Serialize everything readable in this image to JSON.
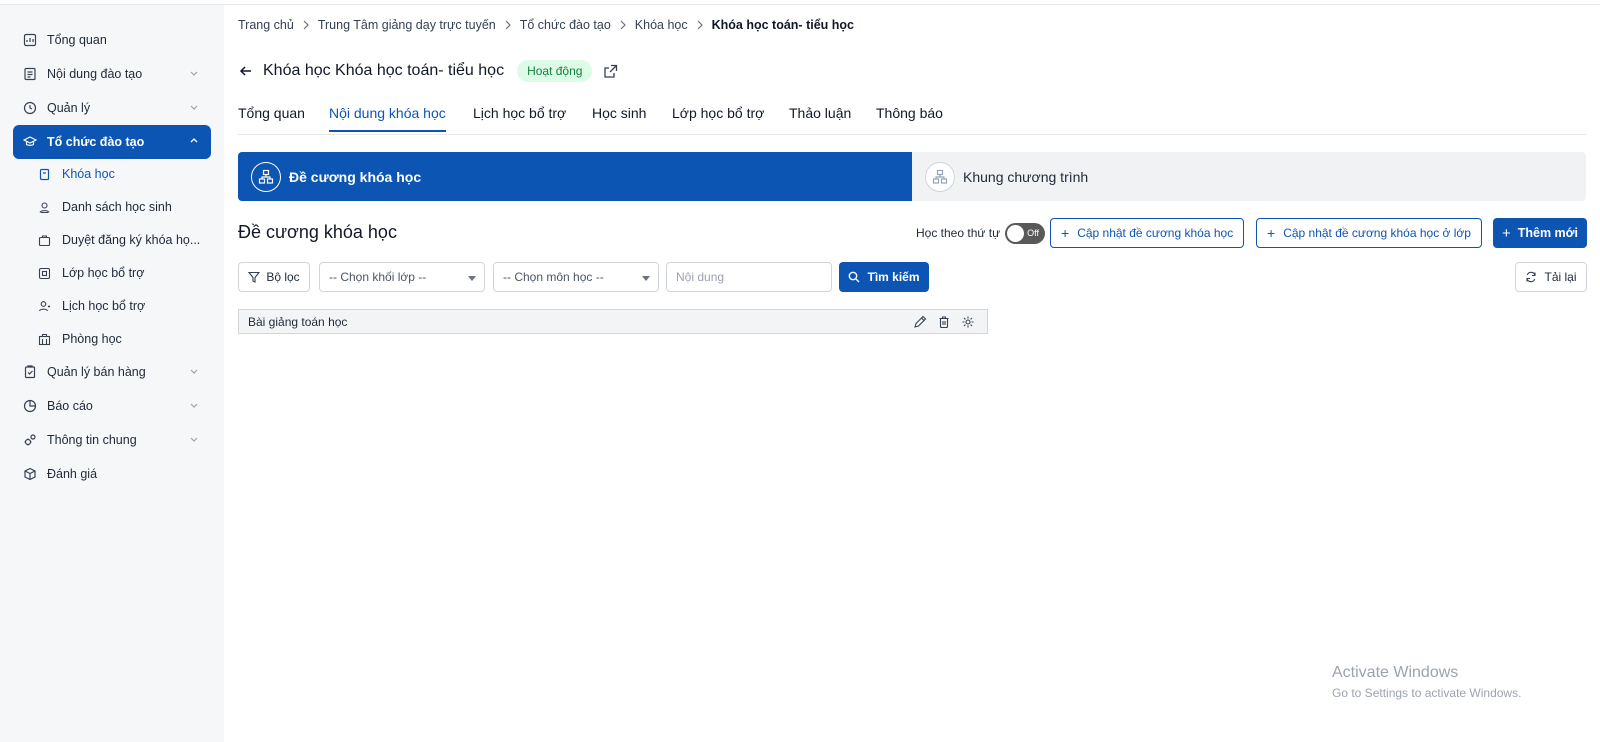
{
  "sidebar": {
    "items": [
      {
        "label": "Tổng quan",
        "icon": "dashboard-icon"
      },
      {
        "label": "Nội dung đào tạo",
        "icon": "document-icon"
      },
      {
        "label": "Quản lý",
        "icon": "check-circle-icon"
      },
      {
        "label": "Tổ chức đào tạo",
        "icon": "graduation-cap-icon"
      },
      {
        "label": "Quản lý bán hàng",
        "icon": "clipboard-check-icon"
      },
      {
        "label": "Báo cáo",
        "icon": "pie-chart-icon"
      },
      {
        "label": "Thông tin chung",
        "icon": "gears-icon"
      },
      {
        "label": "Đánh giá",
        "icon": "cube-icon"
      }
    ],
    "subitems": [
      {
        "label": "Khóa học",
        "icon": "book-icon"
      },
      {
        "label": "Danh sách học sinh",
        "icon": "student-icon"
      },
      {
        "label": "Duyệt đăng ký khóa họ...",
        "icon": "briefcase-icon"
      },
      {
        "label": "Lớp học bổ trợ",
        "icon": "classroom-icon"
      },
      {
        "label": "Lịch học bổ trợ",
        "icon": "user-schedule-icon"
      },
      {
        "label": "Phòng học",
        "icon": "building-icon"
      }
    ]
  },
  "breadcrumb": [
    "Trang chủ",
    "Trung Tâm giảng dạy trực tuyến",
    "Tổ chức đào tạo",
    "Khóa học",
    "Khóa học toán- tiểu học"
  ],
  "header": {
    "title": "Khóa học Khóa học toán- tiểu học",
    "status": "Hoạt động"
  },
  "tabs": [
    "Tổng quan",
    "Nội dung khóa học",
    "Lịch học bổ trợ",
    "Học sinh",
    "Lớp học bổ trợ",
    "Thảo luận",
    "Thông báo"
  ],
  "steps": [
    "Đề cương khóa học",
    "Khung chương trình"
  ],
  "section": {
    "title": "Đề cương khóa học",
    "order_label": "Học theo thứ tự",
    "toggle_text": "Off",
    "update_outline": "Cập nhật đề cương khóa học",
    "update_outline_class": "Cập nhật đề cương khóa học ở lớp",
    "add_new": "Thêm mới"
  },
  "filters": {
    "filter_label": "Bộ lọc",
    "grade_select": "-- Chọn khối lớp --",
    "subject_select": "-- Chọn môn học --",
    "content_placeholder": "Nội dung",
    "search_label": "Tìm kiếm",
    "reload_label": "Tải lại"
  },
  "rows": [
    {
      "title": "Bài giảng toán học"
    }
  ],
  "watermark": {
    "line1": "Activate Windows",
    "line2": "Go to Settings to activate Windows."
  },
  "colors": {
    "primary": "#0d55b2",
    "badge_bg": "#dcfce7",
    "badge_text": "#15803d"
  }
}
